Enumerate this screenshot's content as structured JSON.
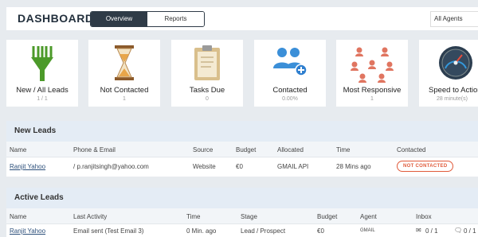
{
  "header": {
    "title": "DASHBOARD",
    "tabs": [
      {
        "label": "Overview",
        "active": true
      },
      {
        "label": "Reports",
        "active": false
      }
    ],
    "agent_filter": "All Agents"
  },
  "cards": [
    {
      "title": "New / All Leads",
      "sub": "1 / 1",
      "icon": "funnel-icon"
    },
    {
      "title": "Not Contacted",
      "sub": "1",
      "icon": "hourglass-icon"
    },
    {
      "title": "Tasks Due",
      "sub": "0",
      "icon": "clipboard-icon"
    },
    {
      "title": "Contacted",
      "sub": "0.00%",
      "icon": "users-plus-icon"
    },
    {
      "title": "Most Responsive",
      "sub": "1",
      "icon": "team-network-icon"
    },
    {
      "title": "Speed to Action",
      "sub": "28 minute(s)",
      "icon": "speedometer-icon"
    }
  ],
  "new_leads": {
    "title": "New Leads",
    "columns": [
      "Name",
      "Phone & Email",
      "Source",
      "Budget",
      "Allocated",
      "Time",
      "Contacted"
    ],
    "rows": [
      {
        "name": "Ranjit Yahoo",
        "contact": "/ p.ranjitsingh@yahoo.com",
        "source": "Website",
        "budget": "€0",
        "allocated": "GMAIL API",
        "time": "28 Mins ago",
        "status": "NOT CONTACTED"
      }
    ]
  },
  "active_leads": {
    "title": "Active Leads",
    "columns": [
      "Name",
      "Last Activity",
      "Time",
      "Stage",
      "Budget",
      "Agent",
      "Inbox"
    ],
    "rows": [
      {
        "name": "Ranjit Yahoo",
        "activity": "Email sent (Test Email 3)",
        "time": "0 Min. ago",
        "stage": "Lead / Prospect",
        "budget": "€0",
        "agent": "GMAIL",
        "inbox_mail": "0 / 1",
        "inbox_chat": "0 / 1"
      }
    ]
  },
  "colors": {
    "accent": "#2f3b47",
    "badge": "#e05a3a",
    "panel_header": "#e4ecf5"
  }
}
